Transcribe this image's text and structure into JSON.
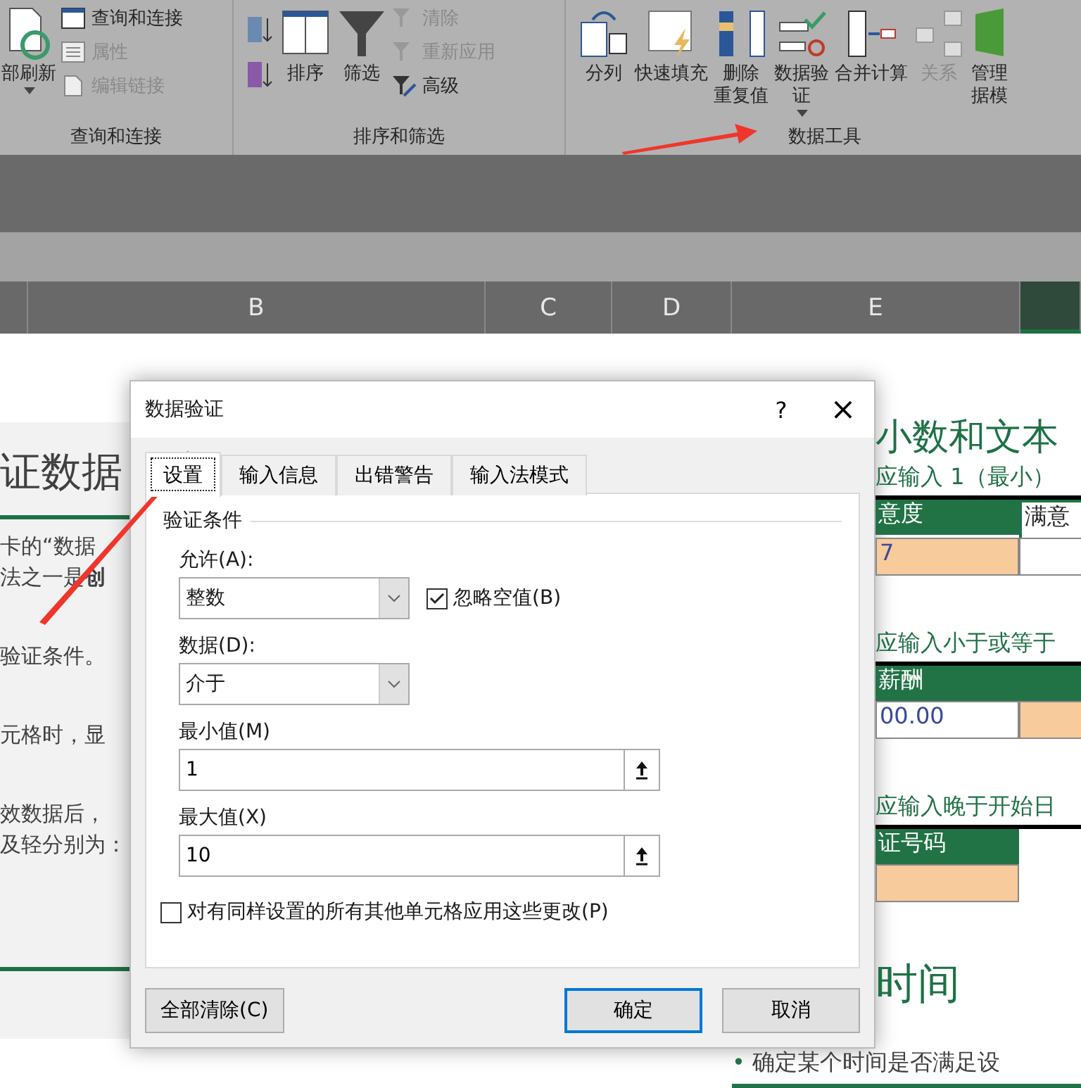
{
  "ribbon": {
    "groups": [
      {
        "label": "查询和连接",
        "buttons": [
          {
            "kind": "large",
            "lines": [
              "部刷新"
            ],
            "caret": true,
            "disabled": false
          },
          {
            "kind": "small",
            "lines": [
              "查询和连接"
            ],
            "disabled": false
          },
          {
            "kind": "small",
            "lines": [
              "属性"
            ],
            "disabled": true
          },
          {
            "kind": "small",
            "lines": [
              "编辑链接"
            ],
            "disabled": true
          }
        ]
      },
      {
        "label": "排序和筛选",
        "buttons": [
          {
            "kind": "sortpair"
          },
          {
            "kind": "large",
            "lines": [
              "排序"
            ],
            "disabled": false
          },
          {
            "kind": "large",
            "lines": [
              "筛选"
            ],
            "disabled": false
          },
          {
            "kind": "small",
            "lines": [
              "清除"
            ],
            "disabled": true
          },
          {
            "kind": "small",
            "lines": [
              "重新应用"
            ],
            "disabled": true
          },
          {
            "kind": "small",
            "lines": [
              "高级"
            ],
            "disabled": false
          }
        ]
      },
      {
        "label": "数据工具",
        "buttons": [
          {
            "kind": "large",
            "lines": [
              "分列"
            ],
            "disabled": false
          },
          {
            "kind": "large",
            "lines": [
              "快速填充"
            ],
            "disabled": false
          },
          {
            "kind": "large",
            "lines": [
              "删除",
              "重复值"
            ],
            "disabled": false
          },
          {
            "kind": "large",
            "lines": [
              "数据验",
              "证"
            ],
            "caret": true,
            "disabled": false
          },
          {
            "kind": "large",
            "lines": [
              "合并计算"
            ],
            "disabled": false
          },
          {
            "kind": "large",
            "lines": [
              "关系"
            ],
            "disabled": true
          },
          {
            "kind": "large",
            "lines": [
              "管理",
              "据模"
            ],
            "disabled": false
          }
        ]
      }
    ]
  },
  "columns": [
    {
      "label": "B",
      "selected": false
    },
    {
      "label": "C",
      "selected": false
    },
    {
      "label": "D",
      "selected": false
    },
    {
      "label": "E",
      "selected": false
    },
    {
      "selected": true
    }
  ],
  "sheet_left": {
    "title": "证数据",
    "lines": [
      "卡的“数据",
      "法之一是**创**",
      "验证条件。",
      "元格时，显",
      "效数据后，",
      "及轻分别为："
    ]
  },
  "sheet_right": {
    "heading": "小数和文本",
    "blocks": [
      {
        "caption": "应输入 1（最小）",
        "header": [
          "意度",
          "满意"
        ],
        "cells": [
          {
            "text": "7",
            "highlighted": true
          },
          {
            "text": "",
            "highlighted": false
          }
        ]
      },
      {
        "caption": "应输入小于或等于",
        "header": [
          "薪酬"
        ],
        "cells": [
          {
            "text": "00.00",
            "highlighted": false
          },
          {
            "text": "",
            "highlighted": true
          }
        ]
      },
      {
        "caption": "应输入晚于开始日",
        "header": [
          "证号码"
        ],
        "cells": [
          {
            "text": "",
            "highlighted": true
          }
        ]
      }
    ],
    "heading2": "时间",
    "bullet": "•",
    "bullet_text": "确定某个时间是否满足设"
  },
  "dialog": {
    "title": "数据验证",
    "help": "?",
    "close": "×",
    "tabs": [
      {
        "label": "设置",
        "selected": true
      },
      {
        "label": "输入信息",
        "selected": false
      },
      {
        "label": "出错警告",
        "selected": false
      },
      {
        "label": "输入法模式",
        "selected": false
      }
    ],
    "group": "验证条件",
    "allow": {
      "label": "允许(A):",
      "value": "整数"
    },
    "ignore_blank": {
      "label": "忽略空值(B)",
      "checked": true
    },
    "data": {
      "label": "数据(D):",
      "value": "介于"
    },
    "min": {
      "label": "最小值(M)",
      "value": "1"
    },
    "max": {
      "label": "最大值(X)",
      "value": "10"
    },
    "apply_all": {
      "label": "对有同样设置的所有其他单元格应用这些更改(P)",
      "checked": false
    },
    "buttons": [
      {
        "label": "全部清除(C)",
        "kind": "left"
      },
      {
        "label": "确定",
        "kind": "default"
      },
      {
        "label": "取消",
        "kind": "normal"
      }
    ]
  }
}
